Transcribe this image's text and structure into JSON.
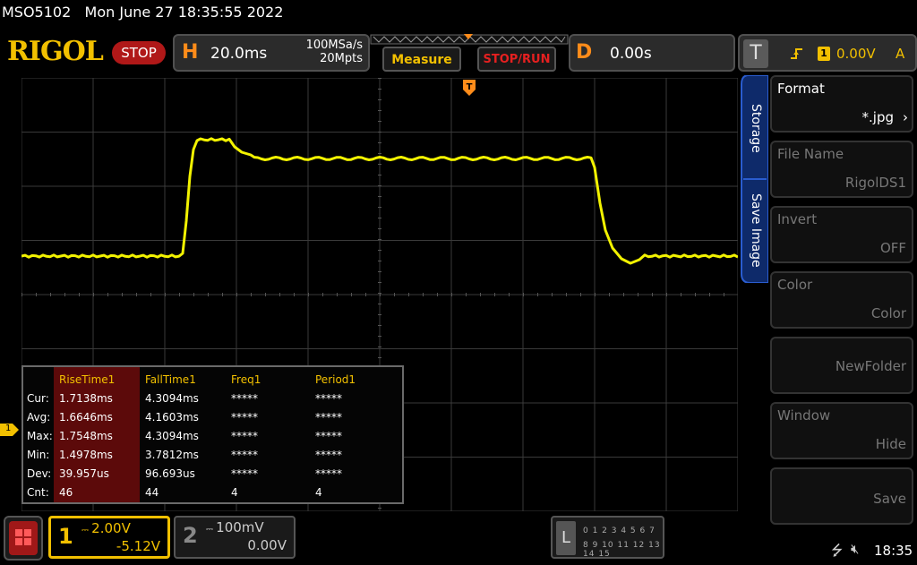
{
  "titlebar": {
    "model": "MSO5102",
    "datetime": "Mon June 27 18:35:55 2022"
  },
  "brand": {
    "logo": "RIGOL",
    "run_state": "STOP"
  },
  "horizontal": {
    "letter": "H",
    "timebase": "20.0ms",
    "sample_rate": "100MSa/s",
    "memory_depth": "20Mpts"
  },
  "toolbar": {
    "measure_label": "Measure",
    "stoprun_label": "STOP/RUN"
  },
  "delay": {
    "letter": "D",
    "value": "0.00s"
  },
  "trigger": {
    "letter": "T",
    "edge_icon": "rising-edge-icon",
    "source": "1",
    "level": "0.00V",
    "mode": "A"
  },
  "measurements": {
    "row_labels": [
      "Cur:",
      "Avg:",
      "Max:",
      "Min:",
      "Dev:",
      "Cnt:"
    ],
    "columns": [
      {
        "header": "RiseTime1",
        "values": [
          "1.7138ms",
          "1.6646ms",
          "1.7548ms",
          "1.4978ms",
          "39.957us",
          "46"
        ]
      },
      {
        "header": "FallTime1",
        "values": [
          "4.3094ms",
          "4.1603ms",
          "4.3094ms",
          "3.7812ms",
          "96.693us",
          "44"
        ]
      },
      {
        "header": "Freq1",
        "values": [
          "*****",
          "*****",
          "*****",
          "*****",
          "*****",
          "4"
        ]
      },
      {
        "header": "Period1",
        "values": [
          "*****",
          "*****",
          "*****",
          "*****",
          "*****",
          "4"
        ]
      }
    ]
  },
  "side_panel": {
    "tabs": [
      "Storage",
      "Save Image"
    ],
    "buttons": [
      {
        "label": "Format",
        "value": "*.jpg"
      },
      {
        "label": "File Name",
        "value": "RigolDS1"
      },
      {
        "label": "Invert",
        "value": "OFF"
      },
      {
        "label": "Color",
        "value": "Color"
      },
      {
        "label": "",
        "value": "NewFolder"
      },
      {
        "label": "Window",
        "value": "Hide"
      },
      {
        "label": "",
        "value": "Save"
      }
    ]
  },
  "channels": {
    "ch1": {
      "number": "1",
      "scale": "2.00V",
      "offset": "-5.12V",
      "color": "#f2c000",
      "marker": "1"
    },
    "ch2": {
      "number": "2",
      "scale": "100mV",
      "offset": "0.00V"
    }
  },
  "logic": {
    "letter": "L",
    "row1": "0 1 2 3  4 5 6 7",
    "row2": "8 9 10 11 12 13 14 15"
  },
  "status": {
    "clock": "18:35"
  },
  "colors": {
    "trace": "#f2f200",
    "accent": "#ff8c1a",
    "brand": "#f2c000"
  }
}
